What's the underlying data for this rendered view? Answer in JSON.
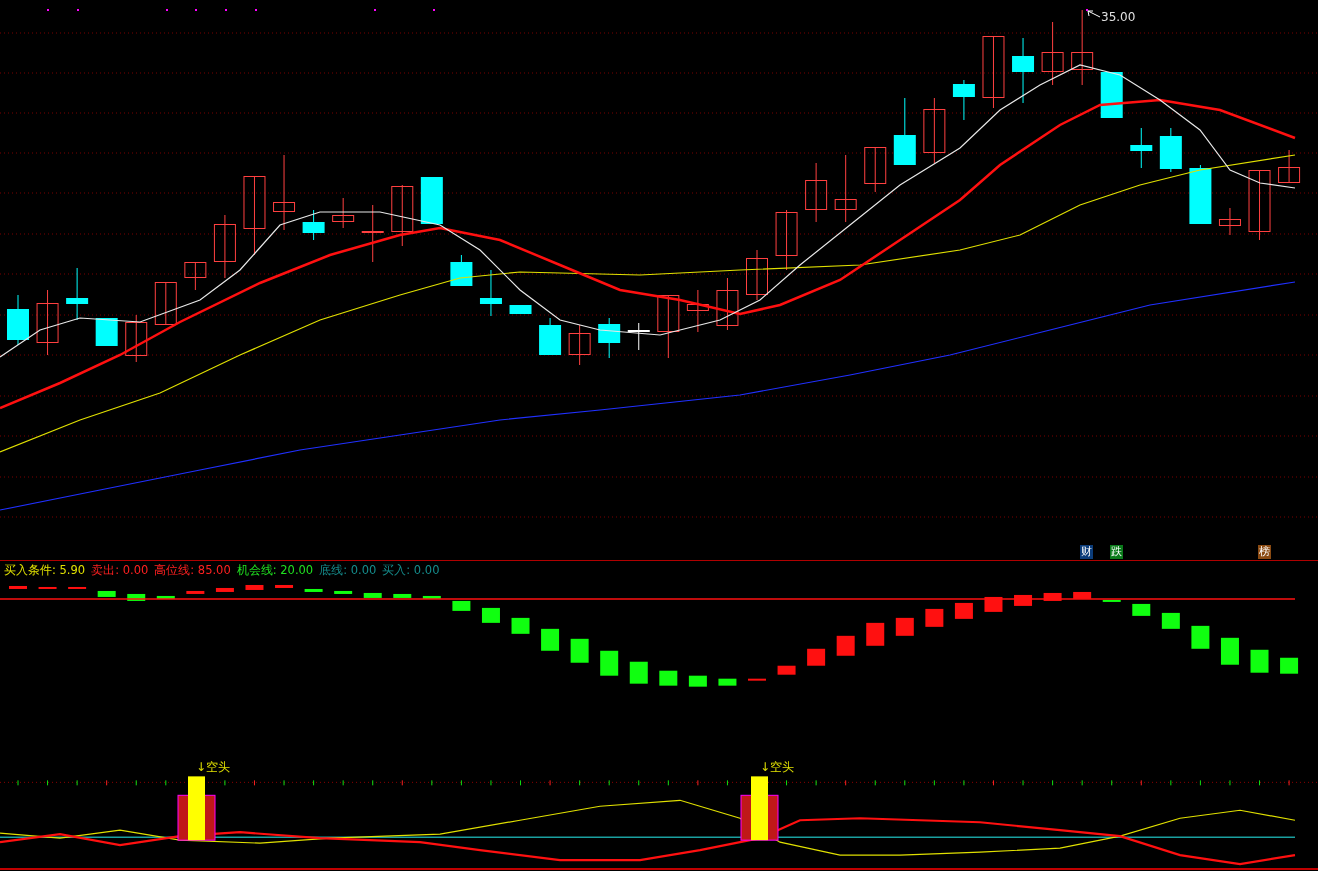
{
  "price_marker": {
    "text": "35.00"
  },
  "badges": [
    {
      "text": "财",
      "color": "#0b3c7a"
    },
    {
      "text": "跌",
      "color": "#0a7a1a"
    },
    {
      "text": "榜",
      "color": "#8a4a12"
    }
  ],
  "indicator_legend": [
    {
      "text": "买入条件: 5.90",
      "color": "#e0e000"
    },
    {
      "text": "卖出: 0.00",
      "color": "#ff2020"
    },
    {
      "text": "高位线: 85.00",
      "color": "#ff2020"
    },
    {
      "text": "机会线: 20.00",
      "color": "#20e020"
    },
    {
      "text": "底线: 0.00",
      "color": "#158c8c"
    },
    {
      "text": "买入: 0.00",
      "color": "#158c8c"
    }
  ],
  "signals": [
    {
      "text": "↓空头"
    },
    {
      "text": "↓空头"
    }
  ]
}
